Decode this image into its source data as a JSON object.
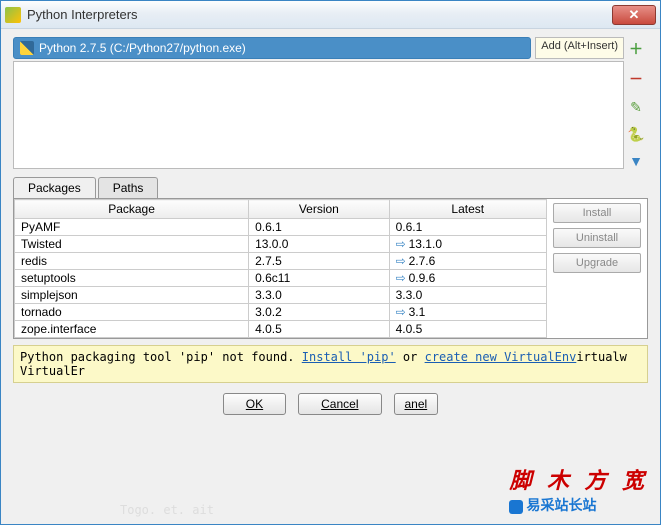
{
  "window": {
    "title": "Python Interpreters"
  },
  "interpreter": {
    "selected": "Python 2.7.5 (C:/Python27/python.exe)",
    "tooltip": "Add (Alt+Insert)"
  },
  "tabs": {
    "packages": "Packages",
    "paths": "Paths"
  },
  "columns": {
    "package": "Package",
    "version": "Version",
    "latest": "Latest"
  },
  "packages": [
    {
      "name": "PyAMF",
      "version": "0.6.1",
      "latest": "0.6.1",
      "upgrade": false
    },
    {
      "name": "Twisted",
      "version": "13.0.0",
      "latest": "13.1.0",
      "upgrade": true
    },
    {
      "name": "redis",
      "version": "2.7.5",
      "latest": "2.7.6",
      "upgrade": true
    },
    {
      "name": "setuptools",
      "version": "0.6c11",
      "latest": "0.9.6",
      "upgrade": true
    },
    {
      "name": "simplejson",
      "version": "3.3.0",
      "latest": "3.3.0",
      "upgrade": false
    },
    {
      "name": "tornado",
      "version": "3.0.2",
      "latest": "3.1",
      "upgrade": true
    },
    {
      "name": "zope.interface",
      "version": "4.0.5",
      "latest": "4.0.5",
      "upgrade": false
    }
  ],
  "actions": {
    "install": "Install",
    "uninstall": "Uninstall",
    "upgrade": "Upgrade"
  },
  "warning": {
    "prefix": "Python packaging tool 'pip' not found. ",
    "link1": "Install 'pip'",
    "middle": " or ",
    "link2": "create new VirtualEnv",
    "suffix": "irtualw VirtualEr"
  },
  "buttons": {
    "ok": "OK",
    "cancel": "Cancel",
    "extra": "anel"
  },
  "overlay": {
    "red": "脚 木 方 宽",
    "blue": "易采站长站"
  }
}
